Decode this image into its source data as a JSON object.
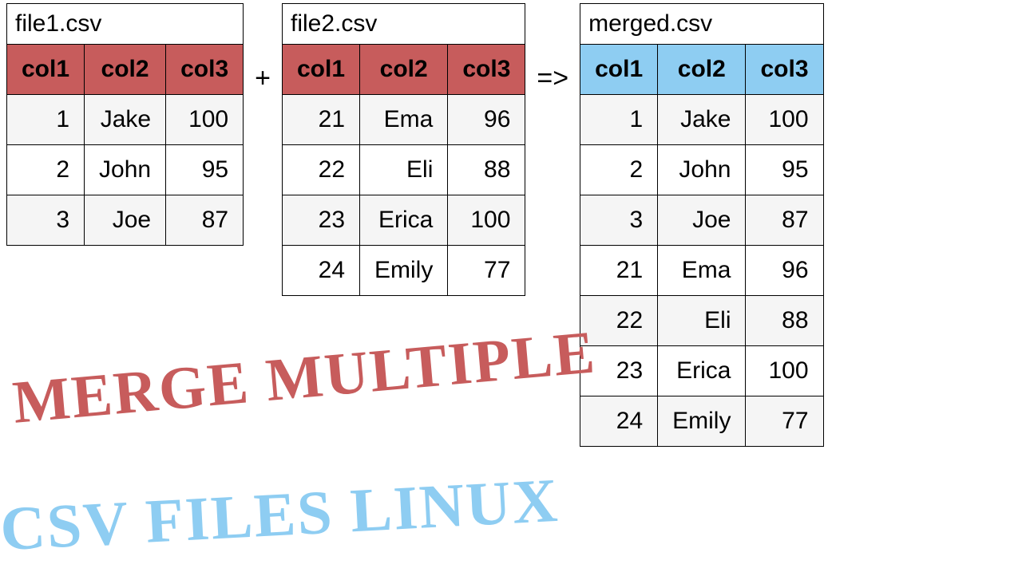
{
  "operators": {
    "plus": "+",
    "arrow": "=>"
  },
  "captions": {
    "line1": "MERGE MULTIPLE",
    "line2": "CSV FILES LINUX"
  },
  "tables": {
    "file1": {
      "title": "file1.csv",
      "headerClass": "header-red",
      "columns": [
        "col1",
        "col2",
        "col3"
      ],
      "rows": [
        [
          "1",
          "Jake",
          "100"
        ],
        [
          "2",
          "John",
          "95"
        ],
        [
          "3",
          "Joe",
          "87"
        ]
      ]
    },
    "file2": {
      "title": "file2.csv",
      "headerClass": "header-red",
      "columns": [
        "col1",
        "col2",
        "col3"
      ],
      "rows": [
        [
          "21",
          "Ema",
          "96"
        ],
        [
          "22",
          "Eli",
          "88"
        ],
        [
          "23",
          "Erica",
          "100"
        ],
        [
          "24",
          "Emily",
          "77"
        ]
      ]
    },
    "merged": {
      "title": "merged.csv",
      "headerClass": "header-blue",
      "columns": [
        "col1",
        "col2",
        "col3"
      ],
      "rows": [
        [
          "1",
          "Jake",
          "100"
        ],
        [
          "2",
          "John",
          "95"
        ],
        [
          "3",
          "Joe",
          "87"
        ],
        [
          "21",
          "Ema",
          "96"
        ],
        [
          "22",
          "Eli",
          "88"
        ],
        [
          "23",
          "Erica",
          "100"
        ],
        [
          "24",
          "Emily",
          "77"
        ]
      ]
    }
  },
  "chart_data": [
    {
      "type": "table",
      "title": "file1.csv",
      "columns": [
        "col1",
        "col2",
        "col3"
      ],
      "rows": [
        [
          1,
          "Jake",
          100
        ],
        [
          2,
          "John",
          95
        ],
        [
          3,
          "Joe",
          87
        ]
      ]
    },
    {
      "type": "table",
      "title": "file2.csv",
      "columns": [
        "col1",
        "col2",
        "col3"
      ],
      "rows": [
        [
          21,
          "Ema",
          96
        ],
        [
          22,
          "Eli",
          88
        ],
        [
          23,
          "Erica",
          100
        ],
        [
          24,
          "Emily",
          77
        ]
      ]
    },
    {
      "type": "table",
      "title": "merged.csv",
      "columns": [
        "col1",
        "col2",
        "col3"
      ],
      "rows": [
        [
          1,
          "Jake",
          100
        ],
        [
          2,
          "John",
          95
        ],
        [
          3,
          "Joe",
          87
        ],
        [
          21,
          "Ema",
          96
        ],
        [
          22,
          "Eli",
          88
        ],
        [
          23,
          "Erica",
          100
        ],
        [
          24,
          "Emily",
          77
        ]
      ]
    }
  ]
}
